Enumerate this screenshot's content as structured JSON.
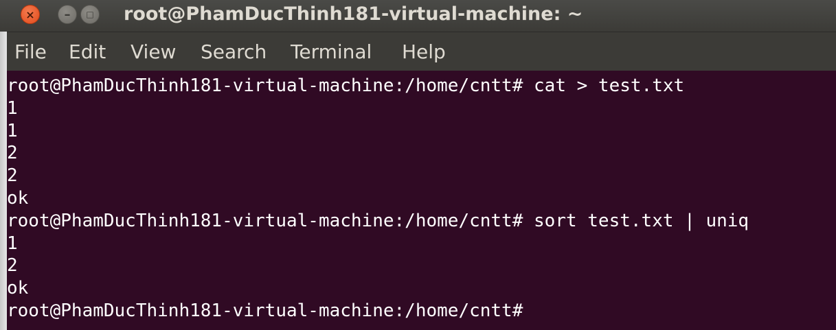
{
  "window": {
    "title": "root@PhamDucThinh181-virtual-machine: ~",
    "close_symbol": "×",
    "minimize_symbol": "–",
    "maximize_symbol": "□"
  },
  "menubar": {
    "items": [
      "File",
      "Edit",
      "View",
      "Search",
      "Terminal",
      "Help"
    ]
  },
  "terminal": {
    "background": "#300a24",
    "foreground": "#ffffff",
    "lines": [
      "root@PhamDucThinh181-virtual-machine:/home/cntt# cat > test.txt",
      "1",
      "1",
      "2",
      "2",
      "ok",
      "root@PhamDucThinh181-virtual-machine:/home/cntt# sort test.txt | uniq",
      "1",
      "2",
      "ok",
      "root@PhamDucThinh181-virtual-machine:/home/cntt#"
    ]
  }
}
